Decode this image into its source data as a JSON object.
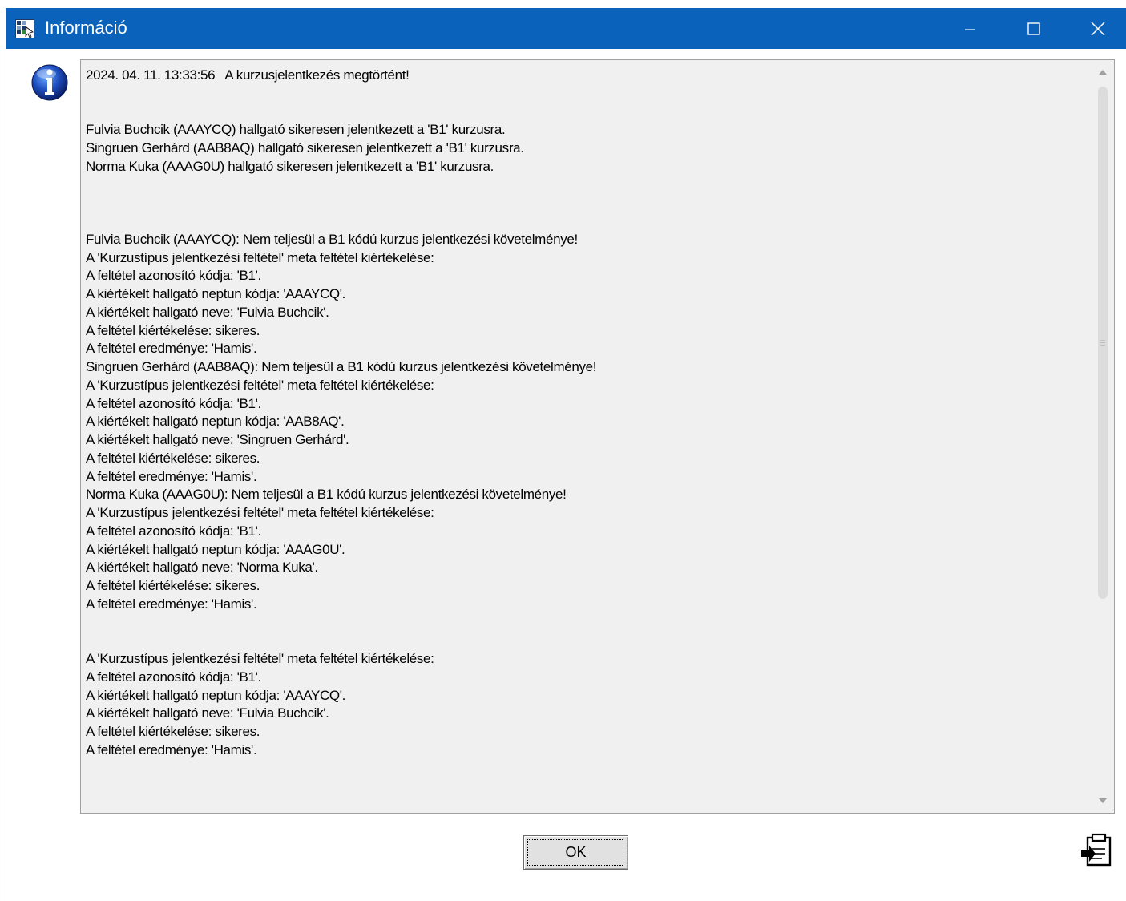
{
  "window": {
    "title": "Információ",
    "accent_color": "#0b62ba",
    "controls": [
      "minimize-icon",
      "maximize-icon",
      "close-icon"
    ]
  },
  "message": {
    "icon": "info-icon",
    "text": "2024. 04. 11. 13:33:56   A kurzusjelentkezés megtörtént!\n\n\nFulvia Buchcik (AAAYCQ) hallgató sikeresen jelentkezett a 'B1' kurzusra.\nSingruen Gerhárd (AAB8AQ) hallgató sikeresen jelentkezett a 'B1' kurzusra.\nNorma Kuka (AAAG0U) hallgató sikeresen jelentkezett a 'B1' kurzusra.\n\n\n\nFulvia Buchcik (AAAYCQ): Nem teljesül a B1 kódú kurzus jelentkezési követelménye!\nA 'Kurzustípus jelentkezési feltétel' meta feltétel kiértékelése:\nA feltétel azonosító kódja: 'B1'.\nA kiértékelt hallgató neptun kódja: 'AAAYCQ'.\nA kiértékelt hallgató neve: 'Fulvia Buchcik'.\nA feltétel kiértékelése: sikeres.\nA feltétel eredménye: 'Hamis'.\nSingruen Gerhárd (AAB8AQ): Nem teljesül a B1 kódú kurzus jelentkezési követelménye!\nA 'Kurzustípus jelentkezési feltétel' meta feltétel kiértékelése:\nA feltétel azonosító kódja: 'B1'.\nA kiértékelt hallgató neptun kódja: 'AAB8AQ'.\nA kiértékelt hallgató neve: 'Singruen Gerhárd'.\nA feltétel kiértékelése: sikeres.\nA feltétel eredménye: 'Hamis'.\nNorma Kuka (AAAG0U): Nem teljesül a B1 kódú kurzus jelentkezési követelménye!\nA 'Kurzustípus jelentkezési feltétel' meta feltétel kiértékelése:\nA feltétel azonosító kódja: 'B1'.\nA kiértékelt hallgató neptun kódja: 'AAAG0U'.\nA kiértékelt hallgató neve: 'Norma Kuka'.\nA feltétel kiértékelése: sikeres.\nA feltétel eredménye: 'Hamis'.\n\n\nA 'Kurzustípus jelentkezési feltétel' meta feltétel kiértékelése:\nA feltétel azonosító kódja: 'B1'.\nA kiértékelt hallgató neptun kódja: 'AAAYCQ'.\nA kiértékelt hallgató neve: 'Fulvia Buchcik'.\nA feltétel kiértékelése: sikeres.\nA feltétel eredménye: 'Hamis'."
  },
  "buttons": {
    "ok_label": "OK",
    "copy_icon": "copy-to-clipboard-icon"
  }
}
